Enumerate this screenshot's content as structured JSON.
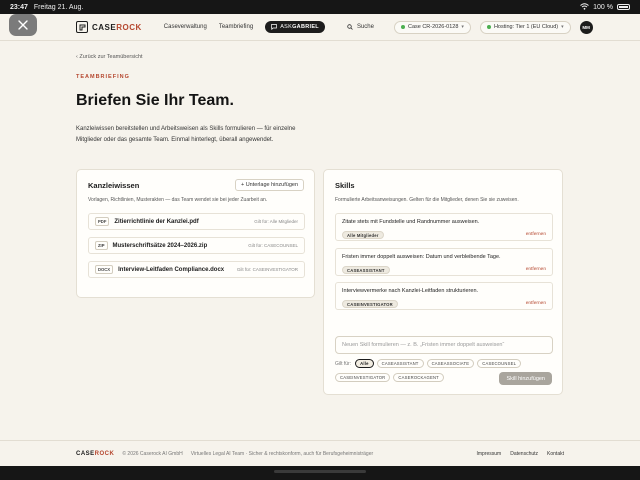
{
  "status_bar": {
    "time": "23:47",
    "date": "Freitag 21. Aug.",
    "battery": "100 %"
  },
  "nav": {
    "logo_case": "CASE",
    "logo_rock": "ROCK",
    "link_caseverwaltung": "Caseverwaltung",
    "link_teambriefing": "Teambriefing",
    "ask_prefix": "ASK",
    "ask_name": "GABRIEL",
    "search": "Suche",
    "case_label": "Case CR-2026-0128",
    "hosting_label": "Hosting: Tier 1 (EU Cloud)",
    "avatar": "MM"
  },
  "header": {
    "back": "‹ Zurück zur Teamübersicht",
    "eyebrow": "TEAMBRIEFING",
    "title": "Briefen Sie Ihr Team.",
    "intro": "Kanzleiwissen bereitstellen und Arbeitsweisen als Skills formulieren — für einzelne Mitglieder oder das gesamte Team. Einmal hinterlegt, überall angewendet."
  },
  "kanzlei": {
    "title": "Kanzleiwissen",
    "upload": "+ Unterlage hinzufügen",
    "subtitle": "Vorlagen, Richtlinien, Musterakten — das Team wendet sie bei jeder Zuarbeit an.",
    "docs": [
      {
        "type": "PDF",
        "name": "Zitierrichtlinie der Kanzlei.pdf",
        "scope": "Gilt für: Alle Mitglieder"
      },
      {
        "type": "ZIP",
        "name": "Musterschriftsätze 2024–2026.zip",
        "scope": "Gilt für: CASECOUNSEL"
      },
      {
        "type": "DOCX",
        "name": "Interview-Leitfaden Compliance.docx",
        "scope": "Gilt für: CASEINVESTIGATOR"
      }
    ]
  },
  "skills": {
    "title": "Skills",
    "subtitle": "Formulierte Arbeitsanweisungen. Gelten für die Mitglieder, denen Sie sie zuweisen.",
    "remove": "entfernen",
    "items": [
      {
        "text": "Zitate stets mit Fundstelle und Randnummer ausweisen.",
        "tag": "Alle Mitglieder"
      },
      {
        "text": "Fristen immer doppelt ausweisen: Datum und verbleibende Tage.",
        "tag": "CASEASSISTANT"
      },
      {
        "text": "Interviewvermerke nach Kanzlei-Leitfaden strukturieren.",
        "tag": "CASEINVESTIGATOR"
      }
    ],
    "input_placeholder": "Neuen Skill formulieren — z. B. „Fristen immer doppelt ausweisen“",
    "scope_label": "Gilt für:",
    "chips_row1": [
      "Alle",
      "CASEASSISTANT",
      "CASEASSOCIATE",
      "CASECOUNSEL"
    ],
    "chips_row2": [
      "CASEINVESTIGATOR",
      "CASEROCKAGENT"
    ],
    "add_button": "Skill hinzufügen"
  },
  "footer": {
    "logo_case": "CASE",
    "logo_rock": "ROCK",
    "copyright": "© 2026 Caserock AI GmbH",
    "description": "Virtuelles Legal AI Team · Sicher & rechtskonform, auch für Berufsgeheimnisträger",
    "links": [
      "Impressum",
      "Datenschutz",
      "Kontakt"
    ]
  },
  "colors": {
    "accent": "#b5472f",
    "background": "#f6f3ec",
    "dark": "#1c1c1c",
    "status_green": "#4caf50"
  }
}
